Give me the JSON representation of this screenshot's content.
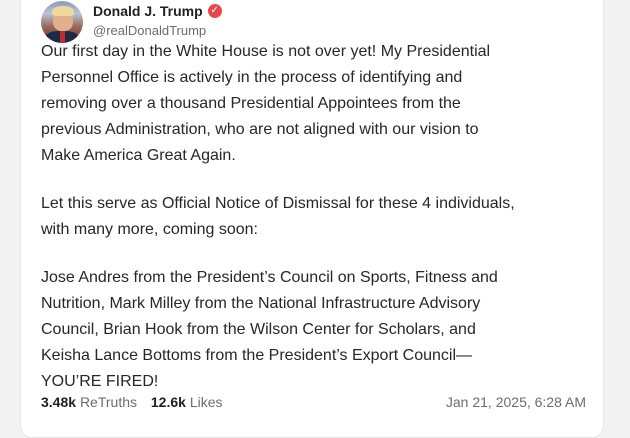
{
  "post": {
    "author_name": "Donald J. Trump",
    "author_handle": "@realDonaldTrump",
    "verified_icon": "checkmark-badge",
    "verified_color": "#e5484d",
    "paragraph1_lines": [
      "Our first day in the White House is not over yet! My Presidential",
      "Personnel Office is actively in the process of identifying and",
      "removing over a thousand Presidential Appointees from the",
      "previous Administration, who are not aligned with our vision to",
      "Make America Great Again."
    ],
    "paragraph2_lines": [
      "Let this serve as Official Notice of Dismissal for these 4 individuals,",
      "with many more, coming soon:"
    ],
    "paragraph3_lines": [
      "Jose Andres from the President’s Council on Sports, Fitness and",
      "Nutrition, Mark Milley from the National Infrastructure Advisory",
      "Council, Brian Hook from the Wilson Center for Scholars, and",
      "Keisha Lance Bottoms from the President’s Export Council—",
      "YOU’RE FIRED!"
    ],
    "retruths_count": "3.48k",
    "retruths_label": "ReTruths",
    "likes_count": "12.6k",
    "likes_label": "Likes",
    "timestamp": "Jan 21, 2025, 6:28 AM"
  }
}
